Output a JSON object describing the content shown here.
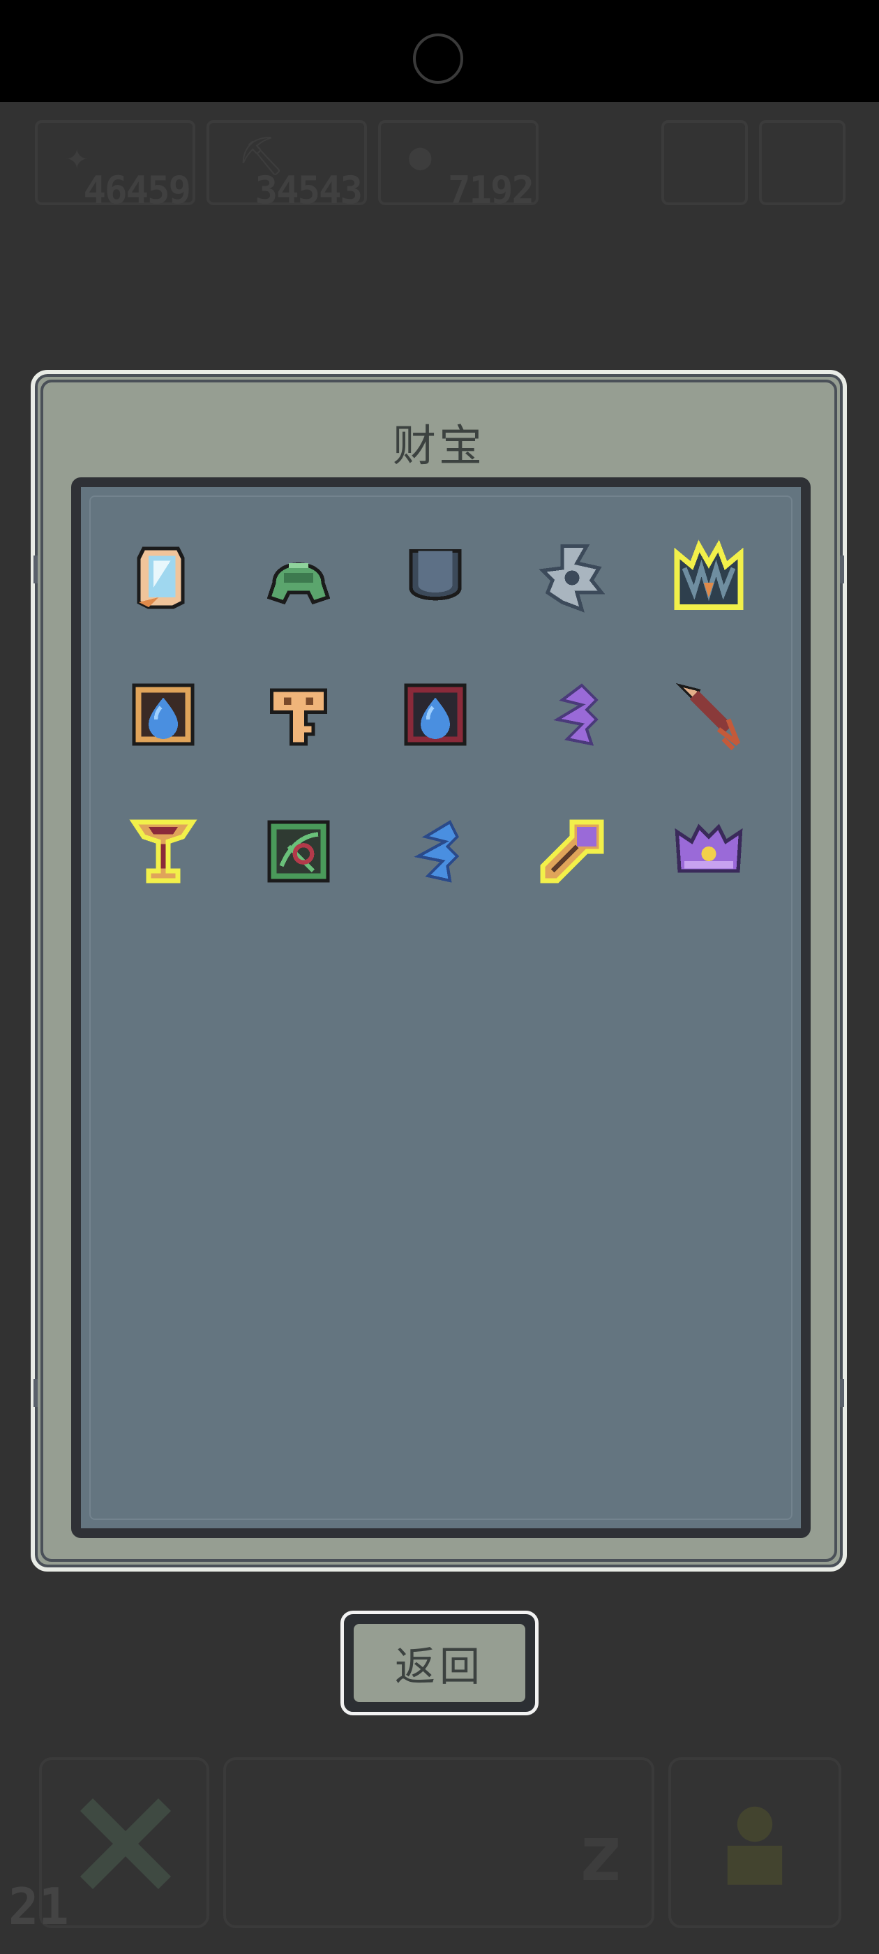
{
  "hud": {
    "resource_1": "46459",
    "resource_2": "34543",
    "resource_3": "7192",
    "level": "21"
  },
  "dialog": {
    "title": "财宝",
    "back_label": "返回"
  },
  "items": [
    {
      "name": "crystal-mirror-icon",
      "highlight": false
    },
    {
      "name": "green-helmet-icon",
      "highlight": false
    },
    {
      "name": "iron-cup-icon",
      "highlight": false
    },
    {
      "name": "steel-shuriken-icon",
      "highlight": false
    },
    {
      "name": "spiked-crown-icon",
      "highlight": true
    },
    {
      "name": "water-tome-icon",
      "highlight": false
    },
    {
      "name": "bronze-key-icon",
      "highlight": false
    },
    {
      "name": "water-tome-dark-icon",
      "highlight": false
    },
    {
      "name": "purple-feather-icon",
      "highlight": false
    },
    {
      "name": "copper-arrow-icon",
      "highlight": false
    },
    {
      "name": "golden-chalice-icon",
      "highlight": true
    },
    {
      "name": "vine-tome-icon",
      "highlight": false
    },
    {
      "name": "blue-feather-icon",
      "highlight": false
    },
    {
      "name": "amethyst-key-icon",
      "highlight": true
    },
    {
      "name": "violet-crown-icon",
      "highlight": false
    }
  ],
  "colors": {
    "highlight": "#f2f04a",
    "panel": "#647580",
    "frame": "#969e92"
  }
}
